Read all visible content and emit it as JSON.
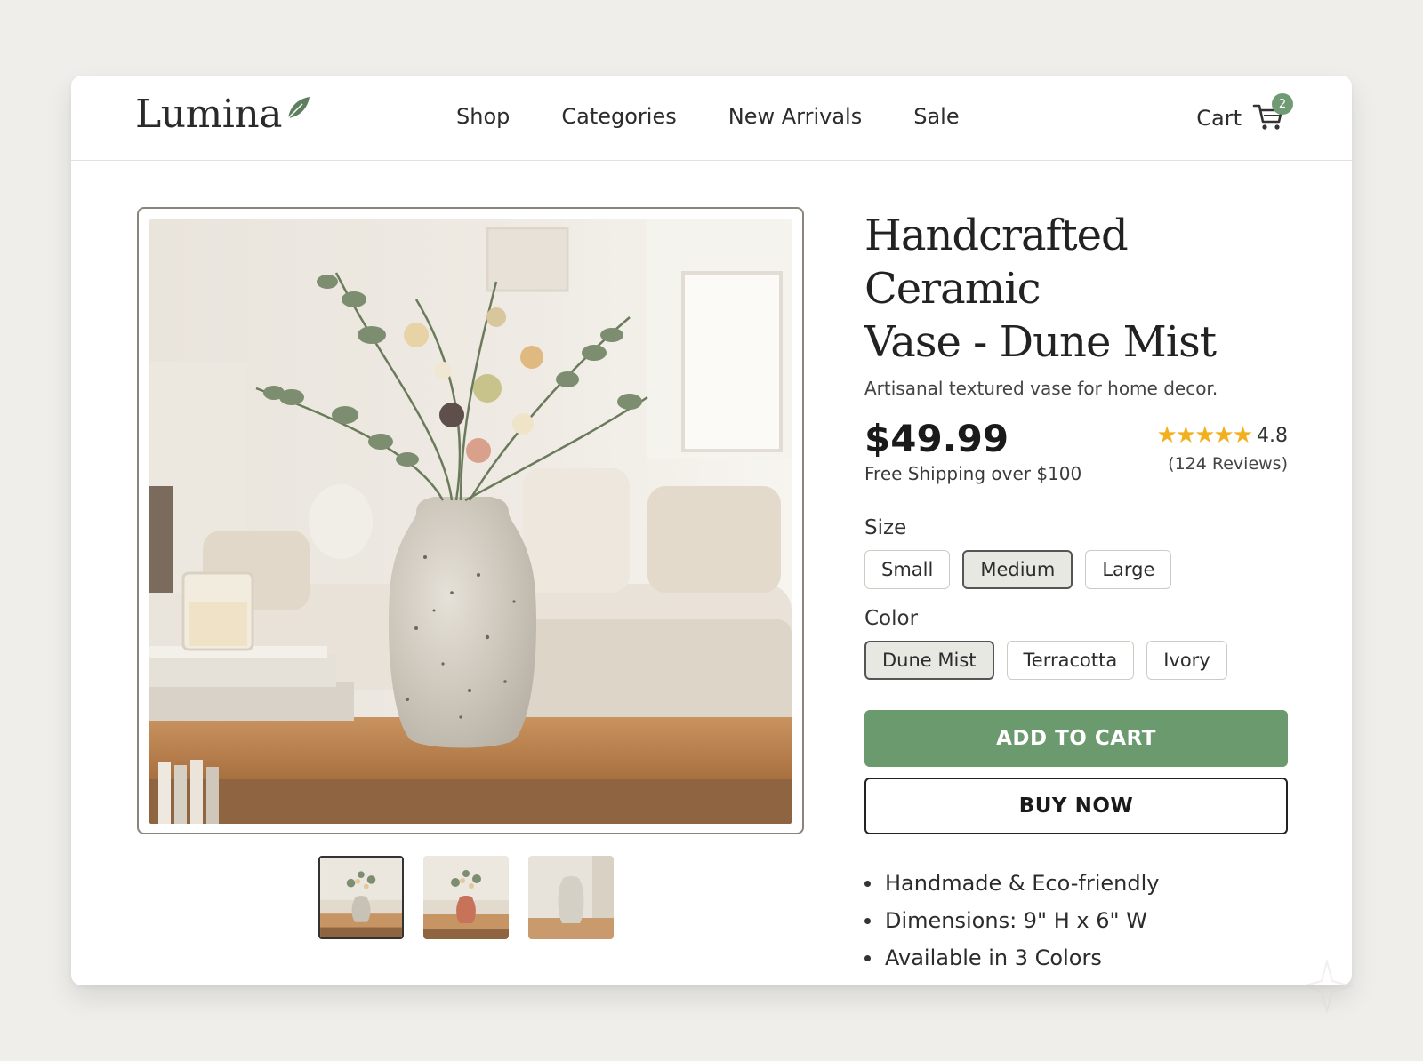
{
  "header": {
    "logo": "Lumina",
    "nav": [
      "Shop",
      "Categories",
      "New Arrivals",
      "Sale"
    ],
    "cart_label": "Cart",
    "cart_count": "2"
  },
  "product": {
    "title_line1": "Handcrafted Ceramic",
    "title_line2": "Vase - Dune Mist",
    "subtitle": "Artisanal textured vase for home decor.",
    "price": "$49.99",
    "shipping": "Free Shipping over $100",
    "rating": "4.8",
    "stars": "★★★★★",
    "reviews": "(124 Reviews)"
  },
  "options": {
    "size_label": "Size",
    "sizes": [
      "Small",
      "Medium",
      "Large"
    ],
    "selected_size": "Medium",
    "color_label": "Color",
    "colors": [
      "Dune Mist",
      "Terracotta",
      "Ivory"
    ],
    "selected_color": "Dune Mist"
  },
  "actions": {
    "add_to_cart": "ADD TO CART",
    "buy_now": "BUY NOW"
  },
  "features": [
    "Handmade & Eco-friendly",
    "Dimensions: 9\" H x 6\" W",
    "Available in 3 Colors"
  ],
  "theme": {
    "accent": "#6a9a6e",
    "star": "#f2b01e",
    "background": "#efeeea"
  },
  "icons": [
    "leaf-icon",
    "cart-icon",
    "star-icon",
    "sparkle-icon"
  ]
}
